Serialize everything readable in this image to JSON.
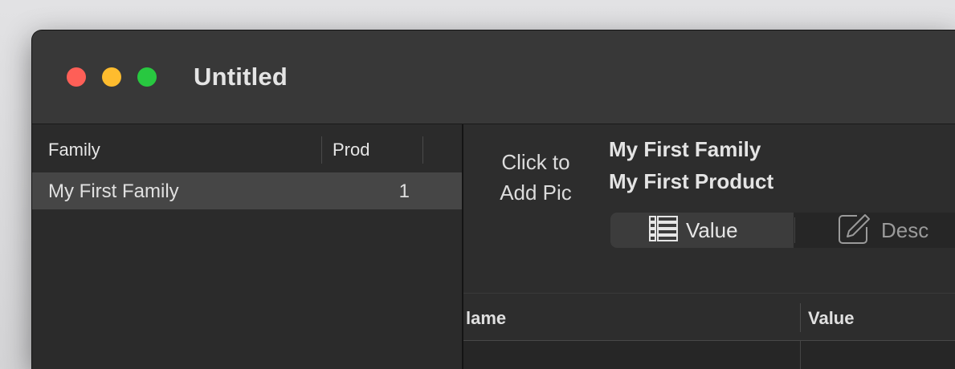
{
  "window": {
    "title": "Untitled"
  },
  "families": {
    "headers": [
      "Family",
      "Prod"
    ],
    "rows": [
      {
        "name": "My First Family",
        "count": "1"
      }
    ]
  },
  "detail": {
    "pic_button": [
      "Click to",
      "Add Pic"
    ],
    "family_name": "My First Family",
    "product_name": "My First Product",
    "tabs": [
      {
        "label": "Value",
        "icon": "list-icon",
        "selected": true
      },
      {
        "label": "Desc",
        "icon": "edit-icon",
        "selected": false
      }
    ],
    "table_headers": [
      "lame",
      "Value"
    ]
  },
  "colors": {
    "traffic_red": "#fe5f57",
    "traffic_yellow": "#febc2e",
    "traffic_green": "#28c840",
    "selection": "#464646"
  }
}
